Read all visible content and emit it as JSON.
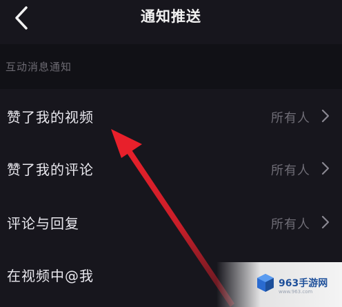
{
  "header": {
    "title": "通知推送",
    "back_icon": "back-chevron-icon"
  },
  "section": {
    "label": "互动消息通知"
  },
  "rows": [
    {
      "label": "赞了我的视频",
      "value": "所有人",
      "icon": "chevron-right-icon"
    },
    {
      "label": "赞了我的评论",
      "value": "所有人",
      "icon": "chevron-right-icon"
    },
    {
      "label": "评论与回复",
      "value": "所有人",
      "icon": "chevron-right-icon"
    },
    {
      "label": "在视频中@我"
    }
  ],
  "annotation": {
    "color": "#e8202b",
    "icon": "red-pointer-arrow-icon"
  },
  "watermark": {
    "text": "963手游网",
    "sub": "www.963.com",
    "icon": "cube-logo-icon"
  }
}
